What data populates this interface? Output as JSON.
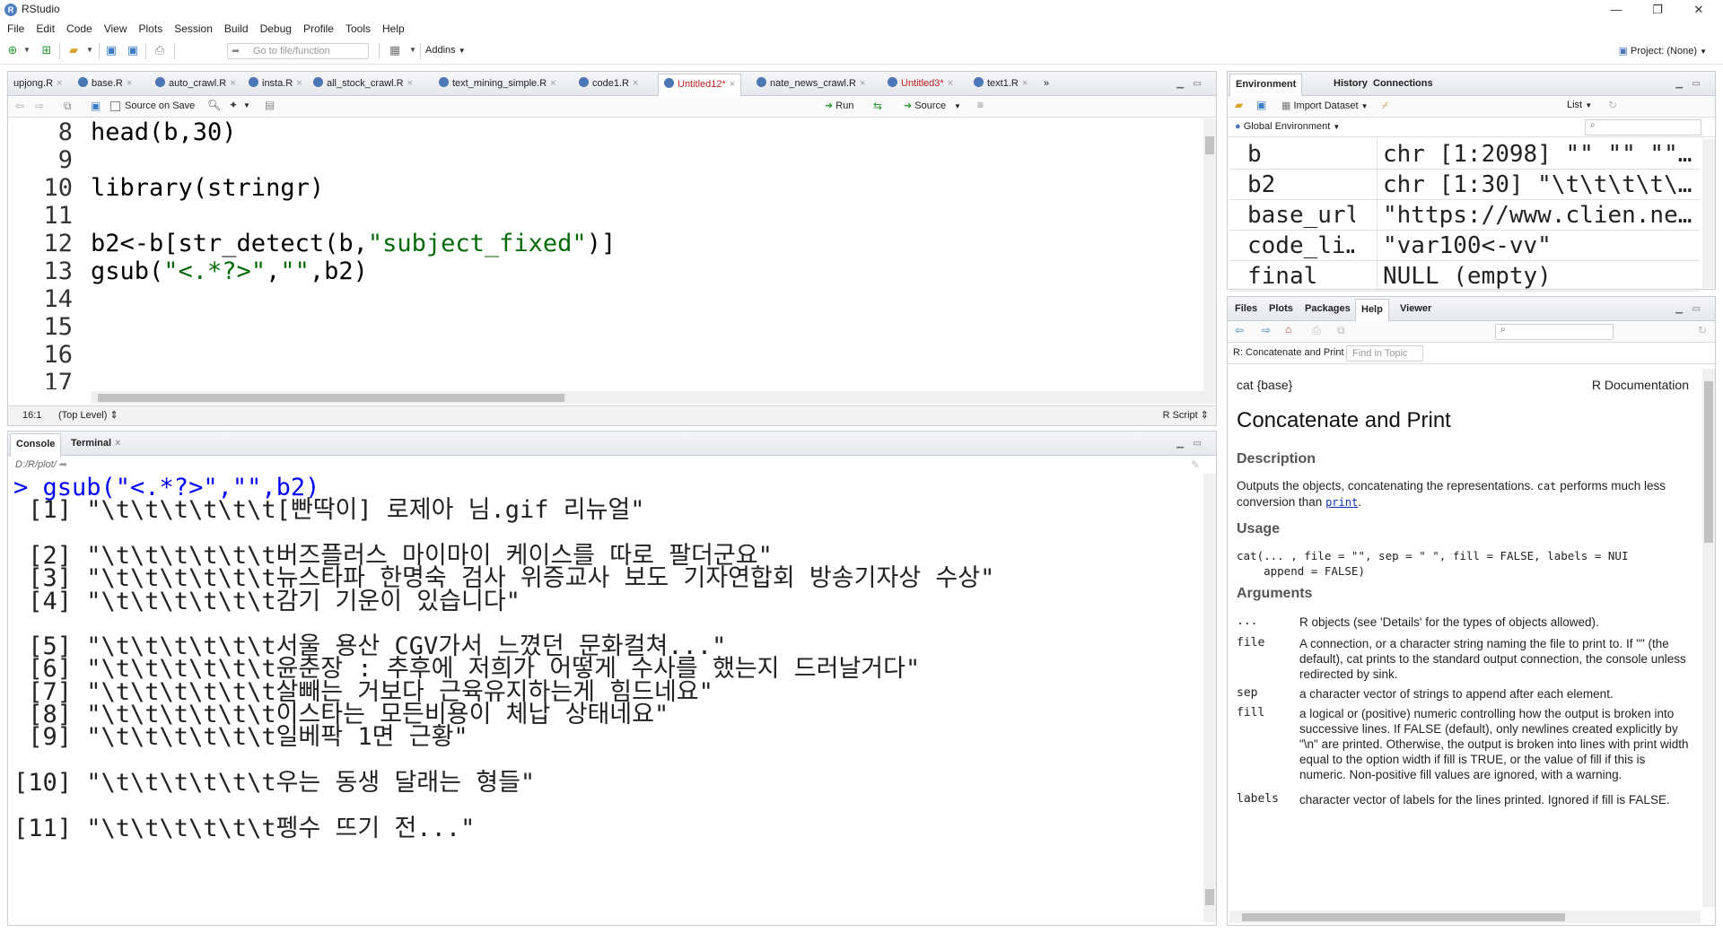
{
  "window": {
    "title": "RStudio",
    "minimize": "—",
    "maximize": "❐",
    "close": "✕"
  },
  "menu": [
    "File",
    "Edit",
    "Code",
    "View",
    "Plots",
    "Session",
    "Build",
    "Debug",
    "Profile",
    "Tools",
    "Help"
  ],
  "toolbar": {
    "goto_placeholder": "Go to file/function",
    "addins": "Addins",
    "project": "Project: (None)"
  },
  "editor": {
    "tabs": [
      {
        "label": "upjong.R",
        "modified": false
      },
      {
        "label": "base.R",
        "modified": false
      },
      {
        "label": "auto_crawl.R",
        "modified": false
      },
      {
        "label": "insta.R",
        "modified": false
      },
      {
        "label": "all_stock_crawl.R",
        "modified": false
      },
      {
        "label": "text_mining_simple.R",
        "modified": false
      },
      {
        "label": "code1.R",
        "modified": false
      },
      {
        "label": "Untitled12*",
        "modified": true
      },
      {
        "label": "nate_news_crawl.R",
        "modified": false
      },
      {
        "label": "Untitled3*",
        "modified": true
      },
      {
        "label": "text1.R",
        "modified": false
      }
    ],
    "source_on_save": "Source on Save",
    "run": "Run",
    "source": "Source",
    "lines": [
      {
        "n": "8",
        "segments": [
          {
            "t": "head(b,30)",
            "c": ""
          }
        ]
      },
      {
        "n": "9",
        "segments": []
      },
      {
        "n": "10",
        "segments": [
          {
            "t": "library(stringr)",
            "c": ""
          }
        ]
      },
      {
        "n": "11",
        "segments": []
      },
      {
        "n": "12",
        "segments": [
          {
            "t": "b2<-b[str_detect(b,",
            "c": ""
          },
          {
            "t": "\"subject_fixed\"",
            "c": "str"
          },
          {
            "t": ")]",
            "c": ""
          }
        ]
      },
      {
        "n": "13",
        "segments": [
          {
            "t": "gsub(",
            "c": ""
          },
          {
            "t": "\"<.*?>\"",
            "c": "str"
          },
          {
            "t": ",",
            "c": ""
          },
          {
            "t": "\"\"",
            "c": "str"
          },
          {
            "t": ",b2)",
            "c": ""
          }
        ]
      },
      {
        "n": "14",
        "segments": []
      },
      {
        "n": "15",
        "segments": []
      },
      {
        "n": "16",
        "segments": []
      },
      {
        "n": "17",
        "segments": []
      }
    ],
    "status": {
      "position": "16:1",
      "scope": "(Top Level)",
      "filetype": "R Script"
    }
  },
  "console": {
    "tabs": [
      "Console",
      "Terminal"
    ],
    "path": "D:/R/plot/",
    "prompt": "> gsub(\"<.*?>\",\"\",b2)",
    "output": [
      " [1] \"\\t\\t\\t\\t\\t\\t[빤딱이] 로제아 님.gif 리뉴얼\"",
      "",
      " [2] \"\\t\\t\\t\\t\\t\\t버즈플러스 마이마이 케이스를 따로 팔더군요\"",
      " [3] \"\\t\\t\\t\\t\\t\\t뉴스타파 한명숙 검사 위증교사 보도 기자연합회 방송기자상 수상\"",
      " [4] \"\\t\\t\\t\\t\\t\\t감기 기운이 있습니다\"",
      "",
      " [5] \"\\t\\t\\t\\t\\t\\t서울 용산 CGV가서 느꼈던 문화컬쳐...\"",
      " [6] \"\\t\\t\\t\\t\\t\\t윤춘장 : 추후에 저희가 어떻게 수사를 했는지 드러날거다\"",
      " [7] \"\\t\\t\\t\\t\\t\\t살빼는 거보다 근육유지하는게 힘드네요\"",
      " [8] \"\\t\\t\\t\\t\\t\\t이스타는 모든비용이 체납 상태네요\"",
      " [9] \"\\t\\t\\t\\t\\t\\t일베팍 1면 근황\"",
      "",
      "[10] \"\\t\\t\\t\\t\\t\\t우는 동생 달래는 형들\"",
      "",
      "[11] \"\\t\\t\\t\\t\\t\\t펭수 뜨기 전...\""
    ]
  },
  "environment": {
    "tabs": [
      "Environment",
      "History",
      "Connections"
    ],
    "import_dataset": "Import Dataset",
    "list_view": "List",
    "scope": "Global Environment",
    "rows": [
      {
        "name": "b",
        "value": "chr [1:2098] \"\" \"\" \"\"…"
      },
      {
        "name": "b2",
        "value": "chr [1:30] \"\\t\\t\\t\\t\\…"
      },
      {
        "name": "base_url",
        "value": "\"https://www.clien.ne…"
      },
      {
        "name": "code_li…",
        "value": "\"var100<-vv\""
      },
      {
        "name": "final",
        "value": "NULL (empty)"
      }
    ]
  },
  "help": {
    "tabs": [
      "Files",
      "Plots",
      "Packages",
      "Help",
      "Viewer"
    ],
    "topic": "R: Concatenate and Print",
    "find_placeholder": "Find in Topic",
    "pkg": "cat {base}",
    "rdoc": "R Documentation",
    "title": "Concatenate and Print",
    "description_h": "Description",
    "description_1": "Outputs the objects, concatenating the representations.",
    "description_code": "cat",
    "description_2": "performs much less conversion than",
    "description_link": "print",
    "usage_h": "Usage",
    "usage_1": "cat(... , file = \"\", sep = \" \", fill = FALSE, labels = NUI",
    "usage_2": "    append = FALSE)",
    "arguments_h": "Arguments",
    "args": [
      {
        "name": "...",
        "desc": "R objects (see 'Details' for the types of objects allowed)."
      },
      {
        "name": "file",
        "desc": "A connection, or a character string naming the file to print to. If \"\" (the default), cat prints to the standard output connection, the console unless redirected by sink."
      },
      {
        "name": "sep",
        "desc": "a character vector of strings to append after each element."
      },
      {
        "name": "fill",
        "desc": "a logical or (positive) numeric controlling how the output is broken into successive lines. If FALSE (default), only newlines created explicitly by \"\\n\" are printed. Otherwise, the output is broken into lines with print width equal to the option width if fill is TRUE, or the value of fill if this is numeric. Non-positive fill values are ignored, with a warning."
      },
      {
        "name": "labels",
        "desc": "character vector of labels for the lines printed. Ignored if fill is FALSE."
      }
    ]
  },
  "colors": {
    "string": "#036a07",
    "console_prompt": "#0000ff",
    "modified_tab": "#c02020",
    "link": "#0b33b4"
  }
}
